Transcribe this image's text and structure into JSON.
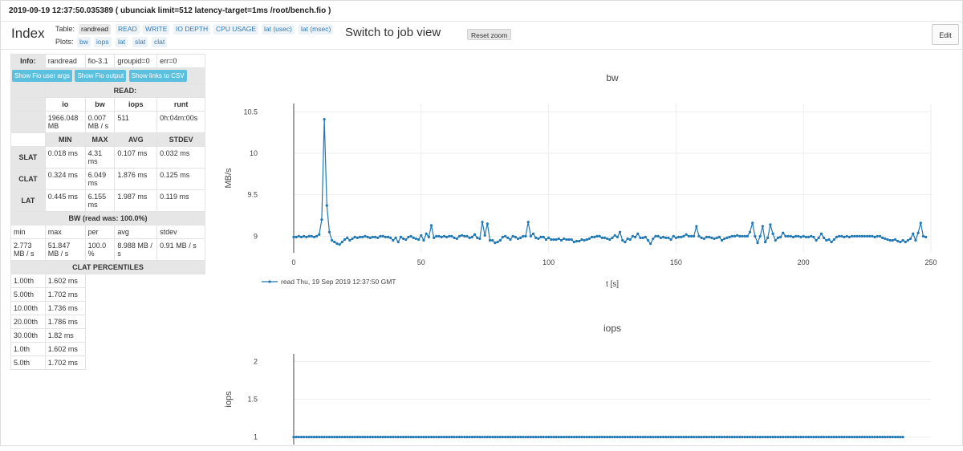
{
  "page_title": "2019-09-19 12:37:50.035389 ( ubunciak limit=512 latency-target=1ms /root/bench.fio )",
  "header": {
    "brand": "Index",
    "table_label": "Table:",
    "table_items": [
      "randread",
      "READ",
      "WRITE",
      "IO DEPTH",
      "CPU USAGE",
      "lat (usec)",
      "lat (msec)"
    ],
    "plots_label": "Plots:",
    "plot_items": [
      "bw",
      "iops",
      "lat",
      "slat",
      "clat"
    ],
    "switch_view": "Switch to job view",
    "reset_zoom": "Reset zoom",
    "edit": "Edit"
  },
  "info": {
    "label": "Info:",
    "values": [
      "randread",
      "fio-3.1",
      "groupid=0",
      "err=0"
    ],
    "buttons": [
      "Show Fio user args",
      "Show Fio output",
      "Show links to CSV"
    ],
    "read_title": "READ:",
    "read_headers": [
      "io",
      "bw",
      "iops",
      "runt"
    ],
    "read_values": [
      "1966.048 MB",
      "0.007 MB / s",
      "511",
      "0h:04m:00s"
    ],
    "lat_headers": [
      "MIN",
      "MAX",
      "AVG",
      "STDEV"
    ],
    "lat_rows": [
      {
        "name": "SLAT",
        "vals": [
          "0.018 ms",
          "4.31 ms",
          "0.107 ms",
          "0.032 ms"
        ]
      },
      {
        "name": "CLAT",
        "vals": [
          "0.324 ms",
          "6.049 ms",
          "1.876 ms",
          "0.125 ms"
        ]
      },
      {
        "name": "LAT",
        "vals": [
          "0.445 ms",
          "6.155 ms",
          "1.987 ms",
          "0.119 ms"
        ]
      }
    ],
    "bw_title": "BW (read was: 100.0%)",
    "bw_headers": [
      "min",
      "max",
      "per",
      "avg",
      "stdev"
    ],
    "bw_values": [
      "2.773 MB / s",
      "51.847 MB / s",
      "100.0 %",
      "8.988 MB / s",
      "0.91 MB / s"
    ],
    "clat_title": "CLAT PERCENTILES",
    "percentiles": [
      [
        "1.00th",
        "1.602 ms"
      ],
      [
        "5.00th",
        "1.702 ms"
      ],
      [
        "10.00th",
        "1.736 ms"
      ],
      [
        "20.00th",
        "1.786 ms"
      ],
      [
        "30.00th",
        "1.82 ms"
      ],
      [
        "1.0th",
        "1.602 ms"
      ],
      [
        "5.0th",
        "1.702 ms"
      ]
    ]
  },
  "chart_data": [
    {
      "type": "line",
      "title": "bw",
      "xlabel": "t [s]",
      "ylabel": "MB/s",
      "xlim": [
        0,
        250
      ],
      "ylim": [
        8.8,
        10.6
      ],
      "xticks": [
        0,
        50,
        100,
        150,
        200,
        250
      ],
      "yticks": [
        9,
        9.5,
        10,
        10.5
      ],
      "grid": true,
      "legend": "bottom-left",
      "color": "#1f77b4",
      "series": [
        {
          "name": "read Thu, 19 Sep 2019 12:37:50 GMT",
          "x_start": 0,
          "x_step": 1,
          "values": [
            8.99,
            8.99,
            9.0,
            8.99,
            9.0,
            8.99,
            9.0,
            9.0,
            8.99,
            9.0,
            9.02,
            9.2,
            10.41,
            9.37,
            9.05,
            8.95,
            8.93,
            8.91,
            8.9,
            8.93,
            8.96,
            8.98,
            8.95,
            8.97,
            8.99,
            8.98,
            8.99,
            8.99,
            9.0,
            8.99,
            8.98,
            8.99,
            8.99,
            8.98,
            9.0,
            9.0,
            8.99,
            8.99,
            8.98,
            8.95,
            8.98,
            8.93,
            8.99,
            8.97,
            8.96,
            8.99,
            9.0,
            8.98,
            8.97,
            8.96,
            9.01,
            8.95,
            9.03,
            8.99,
            9.13,
            8.98,
            9.0,
            9.0,
            8.99,
            9.0,
            8.99,
            9.0,
            9.0,
            8.98,
            8.97,
            9.0,
            9.01,
            9.0,
            9.0,
            8.98,
            8.99,
            9.02,
            8.98,
            8.97,
            9.17,
            9.01,
            9.15,
            8.95,
            8.95,
            8.92,
            8.93,
            8.95,
            8.99,
            9.0,
            8.98,
            8.96,
            9.0,
            8.99,
            8.97,
            8.98,
            9.0,
            9.0,
            9.17,
            9.0,
            9.03,
            8.98,
            8.97,
            8.99,
            8.99,
            8.96,
            8.98,
            8.96,
            8.96,
            8.96,
            8.97,
            8.95,
            8.97,
            8.96,
            8.96,
            8.96,
            8.93,
            8.94,
            8.94,
            8.96,
            8.95,
            8.96,
            8.97,
            8.99,
            8.99,
            9.0,
            9.0,
            8.98,
            8.98,
            8.97,
            8.96,
            8.98,
            9.01,
            8.99,
            9.05,
            8.95,
            8.93,
            8.97,
            8.96,
            9.0,
            8.99,
            9.03,
            8.98,
            8.98,
            8.99,
            8.95,
            8.91,
            8.97,
            9.0,
            9.0,
            8.98,
            8.99,
            8.98,
            8.98,
            8.96,
            9.0,
            8.98,
            8.99,
            8.99,
            9.0,
            9.02,
            9.0,
            9.0,
            9.0,
            9.12,
            9.0,
            8.98,
            8.97,
            8.99,
            8.99,
            8.98,
            8.97,
            8.98,
            8.99,
            8.95,
            8.97,
            8.98,
            8.99,
            9.0,
            9.0,
            9.01,
            9.0,
            9.0,
            9.0,
            9.0,
            9.05,
            9.16,
            9.0,
            8.92,
            9.0,
            9.12,
            8.93,
            8.98,
            9.14,
            9.03,
            8.95,
            8.98,
            8.99,
            9.04,
            9.0,
            9.0,
            9.0,
            8.99,
            9.0,
            9.0,
            8.99,
            9.0,
            8.99,
            8.99,
            9.0,
            8.99,
            8.95,
            8.98,
            9.03,
            8.98,
            8.95,
            8.96,
            8.93,
            8.96,
            8.99,
            9.0,
            9.0,
            8.99,
            9.0,
            8.99,
            9.0,
            9.0,
            9.0,
            9.0,
            9.0,
            9.0,
            9.0,
            9.0,
            9.0,
            8.99,
            9.0,
            9.0,
            8.98,
            8.97,
            8.96,
            8.95,
            8.95,
            8.96,
            8.94,
            8.93,
            8.95,
            8.93,
            8.95,
            8.97,
            9.03,
            8.95,
            9.04,
            9.16,
            9.0,
            8.99
          ]
        }
      ]
    },
    {
      "type": "line",
      "title": "iops",
      "xlabel": "",
      "ylabel": "iops",
      "xlim": [
        0,
        250
      ],
      "ylim": [
        0.9,
        2.1
      ],
      "yticks": [
        1,
        1.5,
        2
      ],
      "grid": true,
      "color": "#1f77b4",
      "series": [
        {
          "x_start": 0,
          "x_step": 1,
          "count": 240,
          "constant": 1
        }
      ]
    }
  ]
}
